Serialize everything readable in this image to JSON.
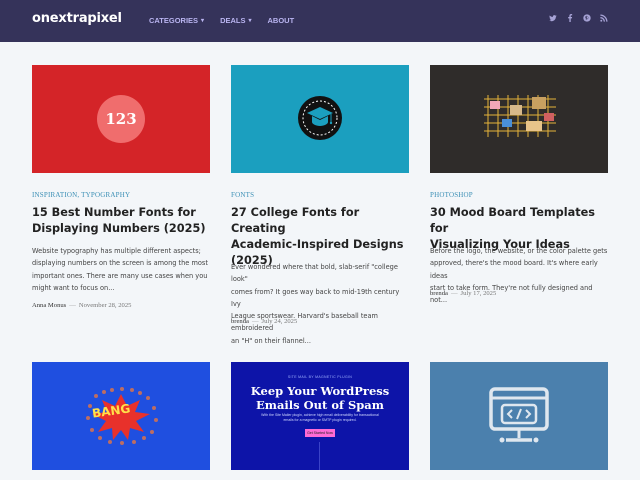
{
  "header": {
    "logo": "onextrapixel",
    "nav": [
      {
        "label": "CATEGORIES",
        "caret": "▾"
      },
      {
        "label": "DEALS",
        "caret": "▾"
      },
      {
        "label": "ABOUT",
        "caret": ""
      }
    ],
    "social_icons": [
      "twitter-icon",
      "facebook-icon",
      "pinterest-icon",
      "rss-icon"
    ]
  },
  "posts": [
    {
      "category": "INSPIRATION, TYPOGRAPHY",
      "title_lines": [
        "15 Best Number Fonts for",
        "Displaying Numbers (2025)"
      ],
      "excerpt_lines": [
        "Website typography has multiple different aspects;",
        "displaying numbers on the screen is among the most",
        "important ones. There are many use cases when you",
        "might want to focus on..."
      ],
      "author": "Anna Monus",
      "sep": "—",
      "date": "November 28, 2025",
      "thumb_color": "#d42428",
      "thumb_text": "123"
    },
    {
      "category": "FONTS",
      "title_lines": [
        "27 College Fonts for Creating",
        "Academic-Inspired Designs",
        "(2025)"
      ],
      "excerpt_lines": [
        "Ever wondered where that bold, slab-serif \"college look\"",
        "comes from? It goes way back to mid-19th century Ivy",
        "League sportswear. Harvard's baseball team embroidered",
        "an \"H\" on their flannel..."
      ],
      "author": "brenda",
      "sep": "—",
      "date": "July 24, 2025",
      "thumb_color": "#1b9fbf"
    },
    {
      "category": "PHOTOSHOP",
      "title_lines": [
        "30 Mood Board Templates for",
        "Visualizing Your Ideas"
      ],
      "excerpt_lines": [
        "Before the logo, the website, or the color palette gets",
        "approved, there's the mood board. It's where early ideas",
        "start to take form. They're not fully designed and not..."
      ],
      "author": "brenda",
      "sep": "—",
      "date": "July 17, 2025",
      "thumb_color": "#2f2c2a"
    },
    {
      "thumb_color": "#1f4fe0",
      "thumb_text": "BANG"
    },
    {
      "thumb_color": "#0d14a8",
      "thumb_tag": "SITE MAIL BY MAGNETIC PLUGIN",
      "thumb_title": "Keep Your WordPress Emails Out of Spam",
      "thumb_sub": "With the Site Mailer plugin, achieve high email deliverability for transactional emails for a magnetic or SMTP plugin required.",
      "thumb_button": "Get Started Now"
    },
    {
      "thumb_color": "#4b80ad"
    }
  ]
}
